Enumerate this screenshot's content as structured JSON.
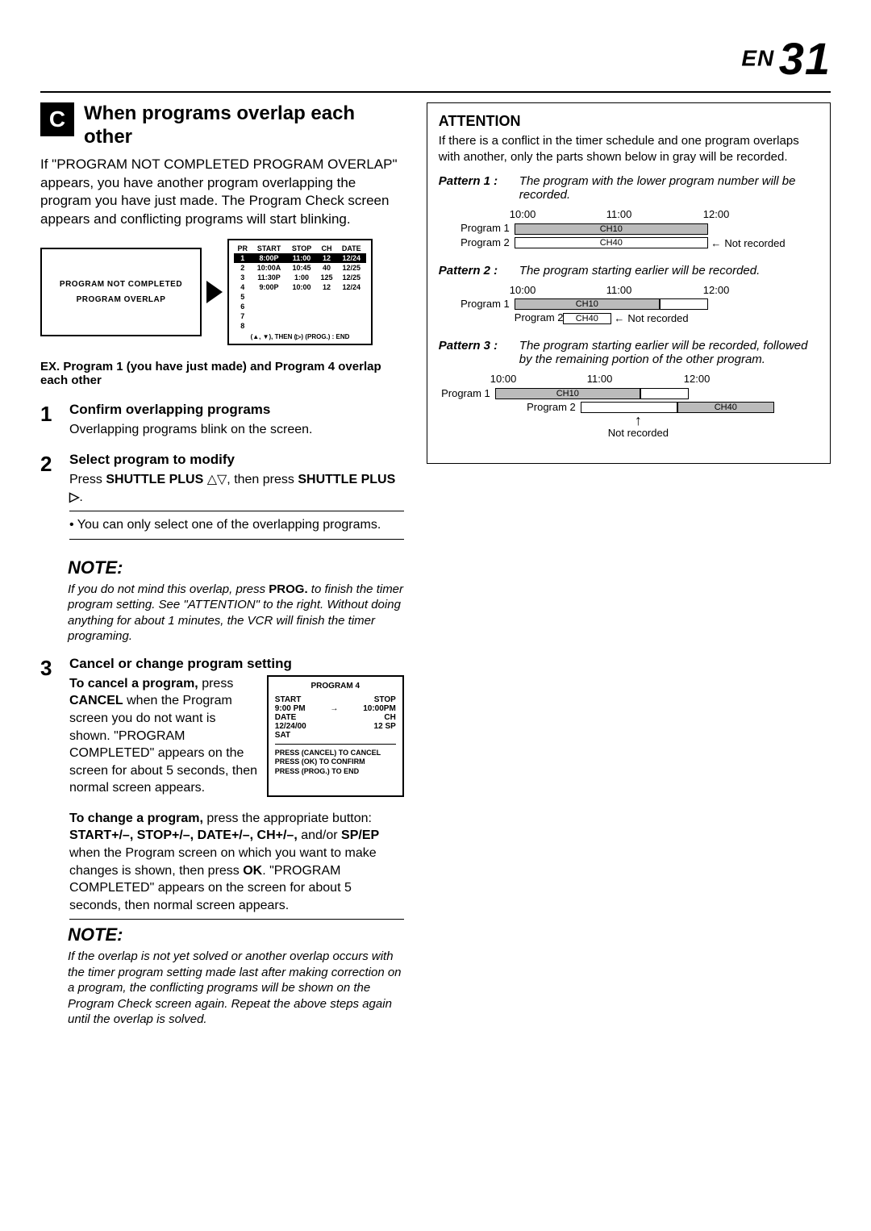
{
  "page": {
    "lang_code": "EN",
    "number": "31"
  },
  "section_c": {
    "badge": "C",
    "title": "When programs overlap each other",
    "intro": "If \"PROGRAM NOT COMPLETED PROGRAM OVERLAP\" appears, you have another program overlapping the program you have just made. The Program Check screen appears and conflicting programs will start blinking.",
    "tv1_line1": "PROGRAM NOT COMPLETED",
    "tv1_line2": "PROGRAM OVERLAP",
    "table": {
      "head": {
        "pr": "PR",
        "start": "START",
        "stop": "STOP",
        "ch": "CH",
        "date": "DATE"
      },
      "rows": [
        {
          "pr": "1",
          "start": "8:00P",
          "stop": "11:00",
          "ch": "12",
          "date": "12/24",
          "hl": true
        },
        {
          "pr": "2",
          "start": "10:00A",
          "stop": "10:45",
          "ch": "40",
          "date": "12/25",
          "hl": false
        },
        {
          "pr": "3",
          "start": "11:30P",
          "stop": "1:00",
          "ch": "125",
          "date": "12/25",
          "hl": false
        },
        {
          "pr": "4",
          "start": "9:00P",
          "stop": "10:00",
          "ch": "12",
          "date": "12/24",
          "hl": false
        },
        {
          "pr": "5",
          "start": "",
          "stop": "",
          "ch": "",
          "date": "",
          "hl": false
        },
        {
          "pr": "6",
          "start": "",
          "stop": "",
          "ch": "",
          "date": "",
          "hl": false
        },
        {
          "pr": "7",
          "start": "",
          "stop": "",
          "ch": "",
          "date": "",
          "hl": false
        },
        {
          "pr": "8",
          "start": "",
          "stop": "",
          "ch": "",
          "date": "",
          "hl": false
        }
      ],
      "footer": "(▲, ▼), THEN (▷) (PROG.) : END"
    },
    "ex": "EX. Program 1 (you have just made) and Program 4 overlap each other",
    "step1": {
      "num": "1",
      "title": "Confirm overlapping programs",
      "text": "Overlapping programs blink on the screen."
    },
    "step2": {
      "num": "2",
      "title": "Select program to modify",
      "text_prefix": "Press ",
      "btn1": "SHUTTLE PLUS",
      "sym1": "△▽",
      "mid": ", then press ",
      "btn2": "SHUTTLE PLUS",
      "sym2": "▷",
      "bullet": "You can only select one of the overlapping programs."
    },
    "note1": {
      "label": "NOTE:",
      "text_a": "If you do not mind this overlap, press ",
      "btn": "PROG.",
      "text_b": " to finish the timer program setting. See \"ATTENTION\" to the right. Without doing anything for about 1 minutes, the VCR will finish the timer programing."
    },
    "step3": {
      "num": "3",
      "title": "Cancel or change program setting",
      "cancel_label": "To cancel a program,",
      "cancel_text_a": "press ",
      "cancel_btn": "CANCEL",
      "cancel_text_b": " when the Program screen you do not want is shown. \"PROGRAM COMPLETED\" appears on the screen for about 5 seconds, then normal screen appears.",
      "program_box": {
        "title": "PROGRAM 4",
        "start_label": "START",
        "stop_label": "STOP",
        "start_val": "9:00 PM",
        "arrow": "→",
        "stop_val": "10:00PM",
        "date_label": "DATE",
        "ch_label": "CH",
        "date_val": "12/24/00",
        "ch_val": "12  SP",
        "day": "SAT",
        "line1": "PRESS (CANCEL) TO CANCEL",
        "line2": "PRESS (OK) TO CONFIRM",
        "line3": "PRESS (PROG.) TO END"
      },
      "change_label": "To change a program,",
      "change_text_a": " press the appropriate button: ",
      "btns": "START+/–, STOP+/–, DATE+/–, CH+/–,",
      "and": " and/or ",
      "spep": "SP/EP",
      "change_text_b": " when the Program screen on which you want to make changes is shown, then press ",
      "ok": "OK",
      "change_text_c": ". \"PROGRAM COMPLETED\" appears on the screen for about 5 seconds, then normal screen appears."
    },
    "note2": {
      "label": "NOTE:",
      "text": "If the overlap is not yet solved or another overlap occurs with the timer program setting made last after making correction on a program, the conflicting programs will be shown on the Program Check screen again. Repeat the above steps again until the overlap is solved."
    }
  },
  "attention": {
    "title": "ATTENTION",
    "intro": "If there is a conflict in the timer schedule and one program overlaps with another, only the parts shown below in gray will be recorded.",
    "p1": {
      "label": "Pattern 1 :",
      "caption": "The program with the lower program number will be recorded.",
      "t1": "10:00",
      "t2": "11:00",
      "t3": "12:00",
      "prog1": "Program 1",
      "ch1": "CH10",
      "prog2": "Program 2",
      "ch2": "CH40",
      "not_rec": "Not recorded"
    },
    "p2": {
      "label": "Pattern 2 :",
      "caption": "The program starting earlier will be recorded.",
      "t1": "10:00",
      "t2": "11:00",
      "t3": "12:00",
      "prog1": "Program 1",
      "ch1": "CH10",
      "prog2": "Program 2",
      "ch2": "CH40",
      "not_rec": "Not recorded"
    },
    "p3": {
      "label": "Pattern 3 :",
      "caption": "The program starting earlier will be recorded, followed by the remaining portion of the other program.",
      "t1": "10:00",
      "t2": "11:00",
      "t3": "12:00",
      "prog1": "Program 1",
      "ch1": "CH10",
      "prog2": "Program 2",
      "ch2": "CH40",
      "not_rec": "Not recorded"
    }
  }
}
